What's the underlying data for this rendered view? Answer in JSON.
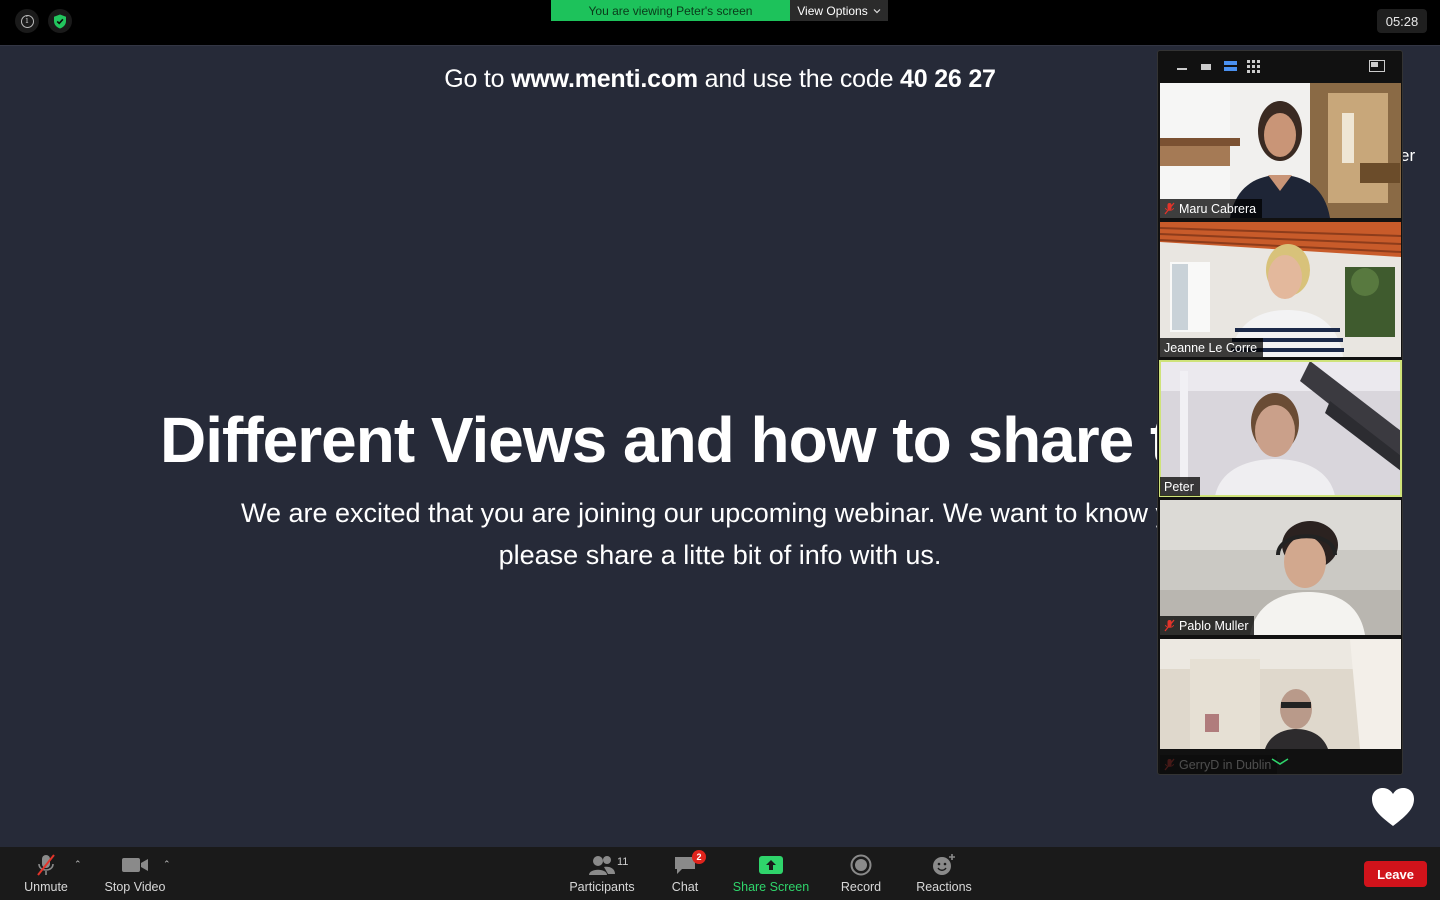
{
  "topbar": {
    "viewing_banner": "You are viewing Peter's screen",
    "view_options_label": "View Options",
    "clock": "05:28"
  },
  "slide": {
    "code_prefix": "Go to ",
    "code_url": "www.menti.com",
    "code_middle": " and use the code ",
    "code_value": "40 26 27",
    "title": "Different Views and how to share t",
    "body_line1": "We are excited that you are joining our upcoming webinar. We want to know you",
    "body_line2": "please share a litte bit of info with us.",
    "edge_text": "er"
  },
  "gallery": {
    "participants": [
      {
        "name": "Maru Cabrera",
        "muted": true
      },
      {
        "name": "Jeanne Le Corre",
        "muted": false
      },
      {
        "name": "Peter",
        "muted": false,
        "active_speaker": true
      },
      {
        "name": "Pablo Muller",
        "muted": true
      },
      {
        "name": "GerryD in Dublin",
        "muted": true
      }
    ]
  },
  "toolbar": {
    "unmute_label": "Unmute",
    "stop_video_label": "Stop Video",
    "participants_label": "Participants",
    "participants_count": "11",
    "chat_label": "Chat",
    "chat_badge": "2",
    "share_screen_label": "Share Screen",
    "record_label": "Record",
    "reactions_label": "Reactions",
    "leave_label": "Leave"
  },
  "colors": {
    "slide_bg": "#262a38",
    "share_green": "#2fd46b",
    "leave_red": "#d1131b",
    "active_speaker": "#cfe37a"
  }
}
